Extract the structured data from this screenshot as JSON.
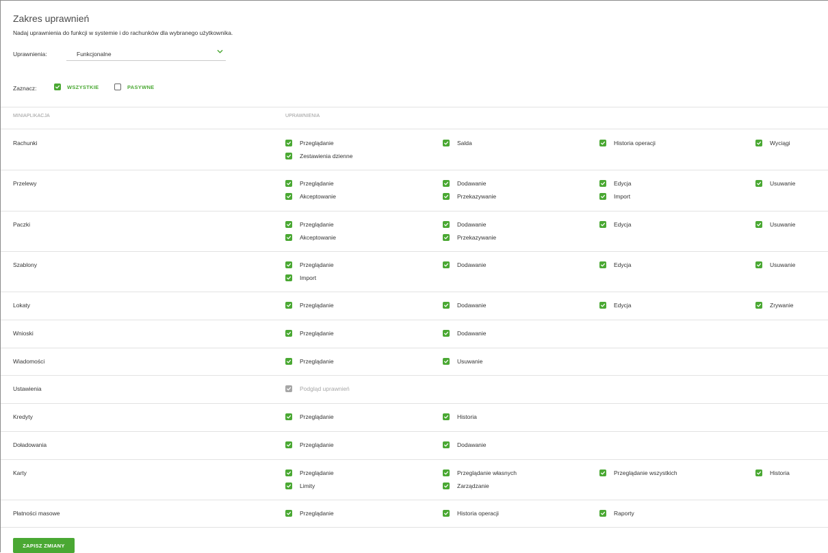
{
  "header": {
    "title": "Zakres uprawnień",
    "subtitle": "Nadaj uprawnienia do funkcji w systemie i do rachunków dla wybranego użytkownika."
  },
  "permissions_select": {
    "label": "Uprawnienia:",
    "value": "Funkcjonalne",
    "icon": "chevron-down-icon"
  },
  "mark": {
    "label": "Zaznacz:",
    "options": [
      {
        "label": "WSZYSTKIE",
        "checked": true
      },
      {
        "label": "PASYWNE",
        "checked": false
      }
    ]
  },
  "table": {
    "col_miniapp": "MINIAPLIKACJA",
    "col_permissions": "UPRAWNIENIA",
    "rows": [
      {
        "name": "Rachunki",
        "perms": [
          {
            "label": "Przeglądanie",
            "checked": true
          },
          {
            "label": "Salda",
            "checked": true
          },
          {
            "label": "Historia operacji",
            "checked": true
          },
          {
            "label": "Wyciągi",
            "checked": true
          },
          {
            "label": "Zestawienia dzienne",
            "checked": true
          }
        ]
      },
      {
        "name": "Przelewy",
        "perms": [
          {
            "label": "Przeglądanie",
            "checked": true
          },
          {
            "label": "Dodawanie",
            "checked": true
          },
          {
            "label": "Edycja",
            "checked": true
          },
          {
            "label": "Usuwanie",
            "checked": true
          },
          {
            "label": "Akceptowanie",
            "checked": true
          },
          {
            "label": "Przekazywanie",
            "checked": true
          },
          {
            "label": "Import",
            "checked": true
          }
        ]
      },
      {
        "name": "Paczki",
        "perms": [
          {
            "label": "Przeglądanie",
            "checked": true
          },
          {
            "label": "Dodawanie",
            "checked": true
          },
          {
            "label": "Edycja",
            "checked": true
          },
          {
            "label": "Usuwanie",
            "checked": true
          },
          {
            "label": "Akceptowanie",
            "checked": true
          },
          {
            "label": "Przekazywanie",
            "checked": true
          }
        ]
      },
      {
        "name": "Szablony",
        "perms": [
          {
            "label": "Przeglądanie",
            "checked": true
          },
          {
            "label": "Dodawanie",
            "checked": true
          },
          {
            "label": "Edycja",
            "checked": true
          },
          {
            "label": "Usuwanie",
            "checked": true
          },
          {
            "label": "Import",
            "checked": true
          }
        ]
      },
      {
        "name": "Lokaty",
        "perms": [
          {
            "label": "Przeglądanie",
            "checked": true
          },
          {
            "label": "Dodawanie",
            "checked": true
          },
          {
            "label": "Edycja",
            "checked": true
          },
          {
            "label": "Zrywanie",
            "checked": true
          }
        ]
      },
      {
        "name": "Wnioski",
        "perms": [
          {
            "label": "Przeglądanie",
            "checked": true
          },
          {
            "label": "Dodawanie",
            "checked": true
          }
        ]
      },
      {
        "name": "Wiadomości",
        "perms": [
          {
            "label": "Przeglądanie",
            "checked": true
          },
          {
            "label": "Usuwanie",
            "checked": true
          }
        ]
      },
      {
        "name": "Ustawienia",
        "perms": [
          {
            "label": "Podgląd uprawnień",
            "checked": true,
            "disabled": true
          }
        ]
      },
      {
        "name": "Kredyty",
        "perms": [
          {
            "label": "Przeglądanie",
            "checked": true
          },
          {
            "label": "Historia",
            "checked": true
          }
        ]
      },
      {
        "name": "Doładowania",
        "perms": [
          {
            "label": "Przeglądanie",
            "checked": true
          },
          {
            "label": "Dodawanie",
            "checked": true
          }
        ]
      },
      {
        "name": "Karty",
        "perms": [
          {
            "label": "Przeglądanie",
            "checked": true
          },
          {
            "label": "Przeglądanie własnych",
            "checked": true
          },
          {
            "label": "Przeglądanie wszystkich",
            "checked": true
          },
          {
            "label": "Historia",
            "checked": true
          },
          {
            "label": "Limity",
            "checked": true
          },
          {
            "label": "Zarządzanie",
            "checked": true
          }
        ]
      },
      {
        "name": "Płatności masowe",
        "perms": [
          {
            "label": "Przeglądanie",
            "checked": true
          },
          {
            "label": "Historia operacji",
            "checked": true
          },
          {
            "label": "Raporty",
            "checked": true
          }
        ]
      }
    ]
  },
  "footer": {
    "save_label": "ZAPISZ ZMIANY"
  },
  "colors": {
    "accent": "#4aa833",
    "disabled": "#a6a6a6",
    "divider": "#e2e2e2"
  }
}
